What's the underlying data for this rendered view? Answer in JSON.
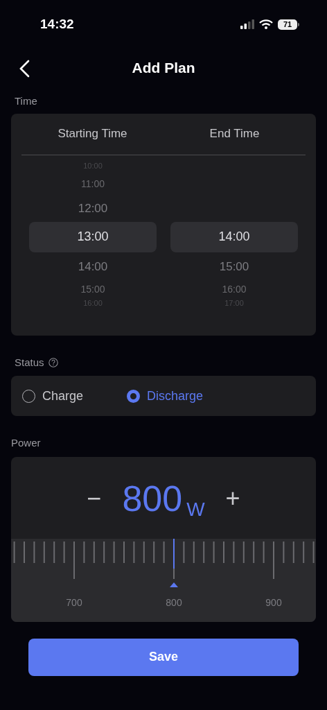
{
  "status_bar": {
    "time": "14:32",
    "battery": "71"
  },
  "header": {
    "title": "Add Plan"
  },
  "time_section": {
    "label": "Time",
    "columns": [
      {
        "heading": "Starting Time",
        "items": [
          {
            "label": "10:00",
            "selected": false
          },
          {
            "label": "11:00",
            "selected": false
          },
          {
            "label": "12:00",
            "selected": false
          },
          {
            "label": "13:00",
            "selected": true
          },
          {
            "label": "14:00",
            "selected": false
          },
          {
            "label": "15:00",
            "selected": false
          },
          {
            "label": "16:00",
            "selected": false
          }
        ]
      },
      {
        "heading": "End Time",
        "items": [
          {
            "label": "14:00",
            "selected": true
          },
          {
            "label": "15:00",
            "selected": false
          },
          {
            "label": "16:00",
            "selected": false
          },
          {
            "label": "17:00",
            "selected": false
          }
        ]
      }
    ]
  },
  "status_section": {
    "label": "Status",
    "options": [
      {
        "label": "Charge",
        "selected": false
      },
      {
        "label": "Discharge",
        "selected": true
      }
    ]
  },
  "power_section": {
    "label": "Power",
    "minus": "−",
    "value": "800",
    "unit": "W",
    "plus": "+",
    "ruler_labels": [
      "700",
      "800",
      "900"
    ]
  },
  "save_button": "Save"
}
